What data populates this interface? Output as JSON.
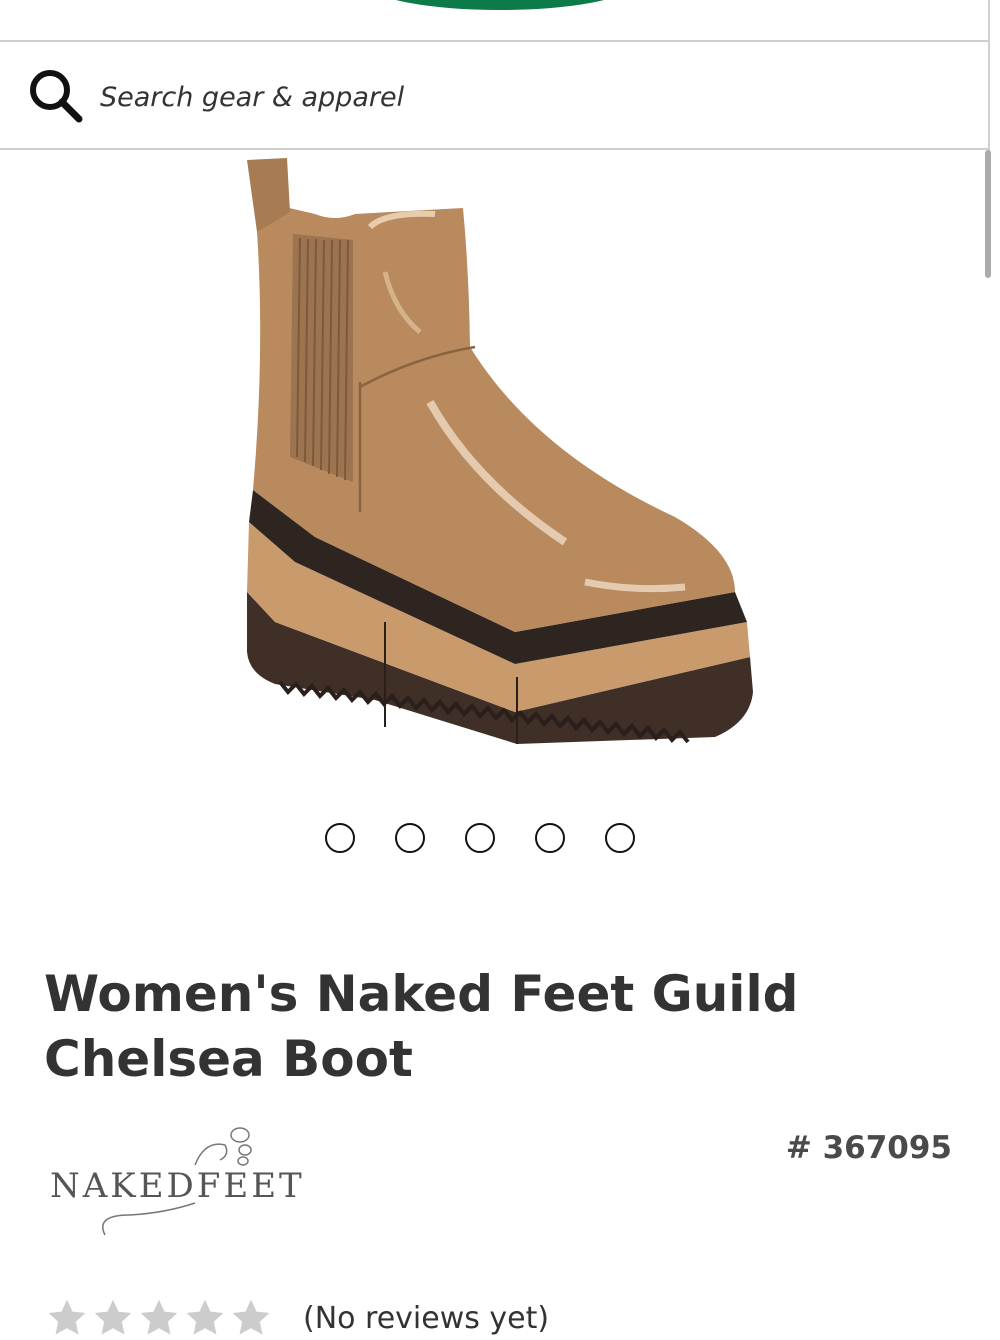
{
  "header": {
    "logo_color": "#0d7a4a"
  },
  "search": {
    "placeholder": "Search gear & apparel",
    "icon": "search-icon"
  },
  "gallery": {
    "image": "chelsea-boot-image",
    "slide_count": 5
  },
  "product": {
    "title": "Women's Naked Feet Guild Chelsea Boot",
    "item_number": "# 367095",
    "brand_logo_text": "NAKEDFEET"
  },
  "reviews": {
    "stars_filled": 0,
    "stars_total": 5,
    "label": "(No reviews yet)"
  },
  "colors": {
    "boot_upper": "#b88a5e",
    "sole_dark": "#4a362c",
    "sole_tan": "#c99a6c",
    "star_empty": "#cccccc"
  }
}
